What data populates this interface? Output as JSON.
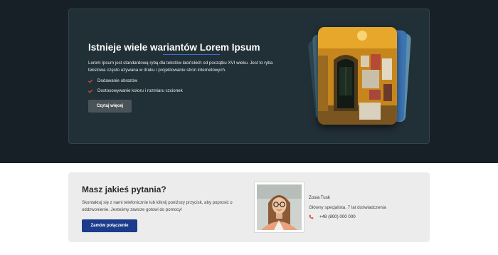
{
  "hero": {
    "title": "Istnieje wiele wariantów Lorem Ipsum",
    "description": "Lorem Ipsum jest standardową rybą dla tekstów łacińskich od początku XVI wieku. Jest to ryba tekstowa często używana w druku i projektowaniu stron internetowych.",
    "features": [
      "Dodawanie obrazów",
      "Dostosowywanie koloru i rozmiaru czcionek"
    ],
    "read_more_label": "Czytaj więcej",
    "accent_color": "#d94b4b"
  },
  "contact": {
    "title": "Masz jakieś pytania?",
    "description": "Skontaktuj się z nami telefonicznie lub kliknij poniższy przycisk, aby poprosić o oddzwonienie. Jesteśmy zawsze gotowi do pomocy!",
    "order_call_label": "Zamów połączenie",
    "person": {
      "name": "Zosia Tusk",
      "role": "Główny specjalista, 7 lat doświadczenia",
      "phone": "+48 (800) 000 000"
    },
    "button_color": "#1c3b8a"
  }
}
